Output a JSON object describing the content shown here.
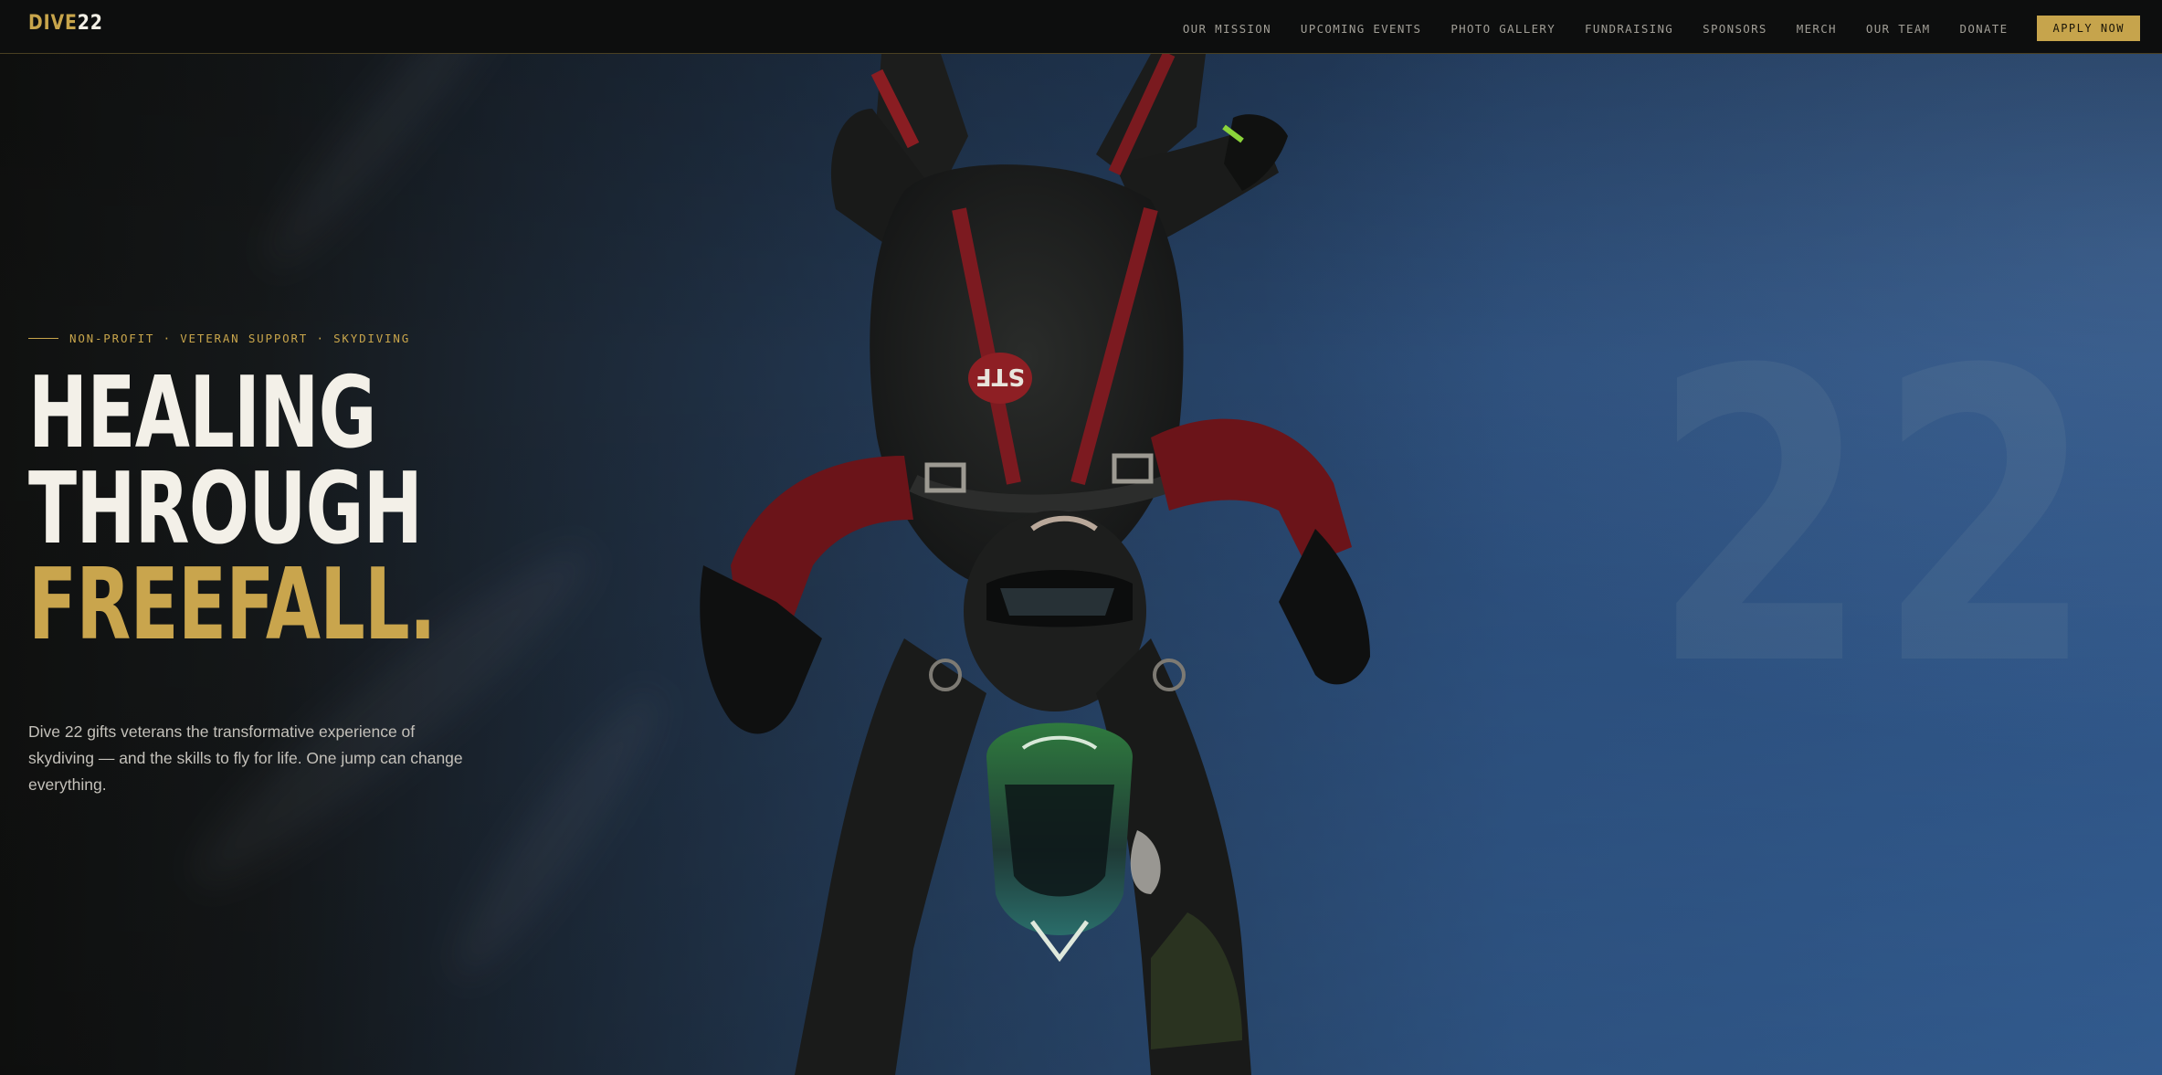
{
  "nav": {
    "logo_primary": "DIVE",
    "logo_secondary": "22",
    "links": [
      "OUR MISSION",
      "UPCOMING EVENTS",
      "PHOTO GALLERY",
      "FUNDRAISING",
      "SPONSORS",
      "MERCH",
      "OUR TEAM",
      "DONATE"
    ],
    "cta_label": "APPLY NOW"
  },
  "hero": {
    "eyebrow": "NON-PROFIT · VETERAN SUPPORT · SKYDIVING",
    "headline": {
      "line1": "HEALING",
      "line2": "THROUGH",
      "line3": "FREEFALL."
    },
    "description": "Dive 22 gifts veterans the transformative experience of skydiving — and the skills to fly for life. One jump can change everything.",
    "watermark": "22",
    "image_subject": "skydiver-in-freefall-photo"
  },
  "colors": {
    "accent_gold": "#c8a54b",
    "nav_background": "#0d0e0e",
    "headline_light": "#f3f0e8",
    "sky_blue": "#3a6aa6"
  }
}
